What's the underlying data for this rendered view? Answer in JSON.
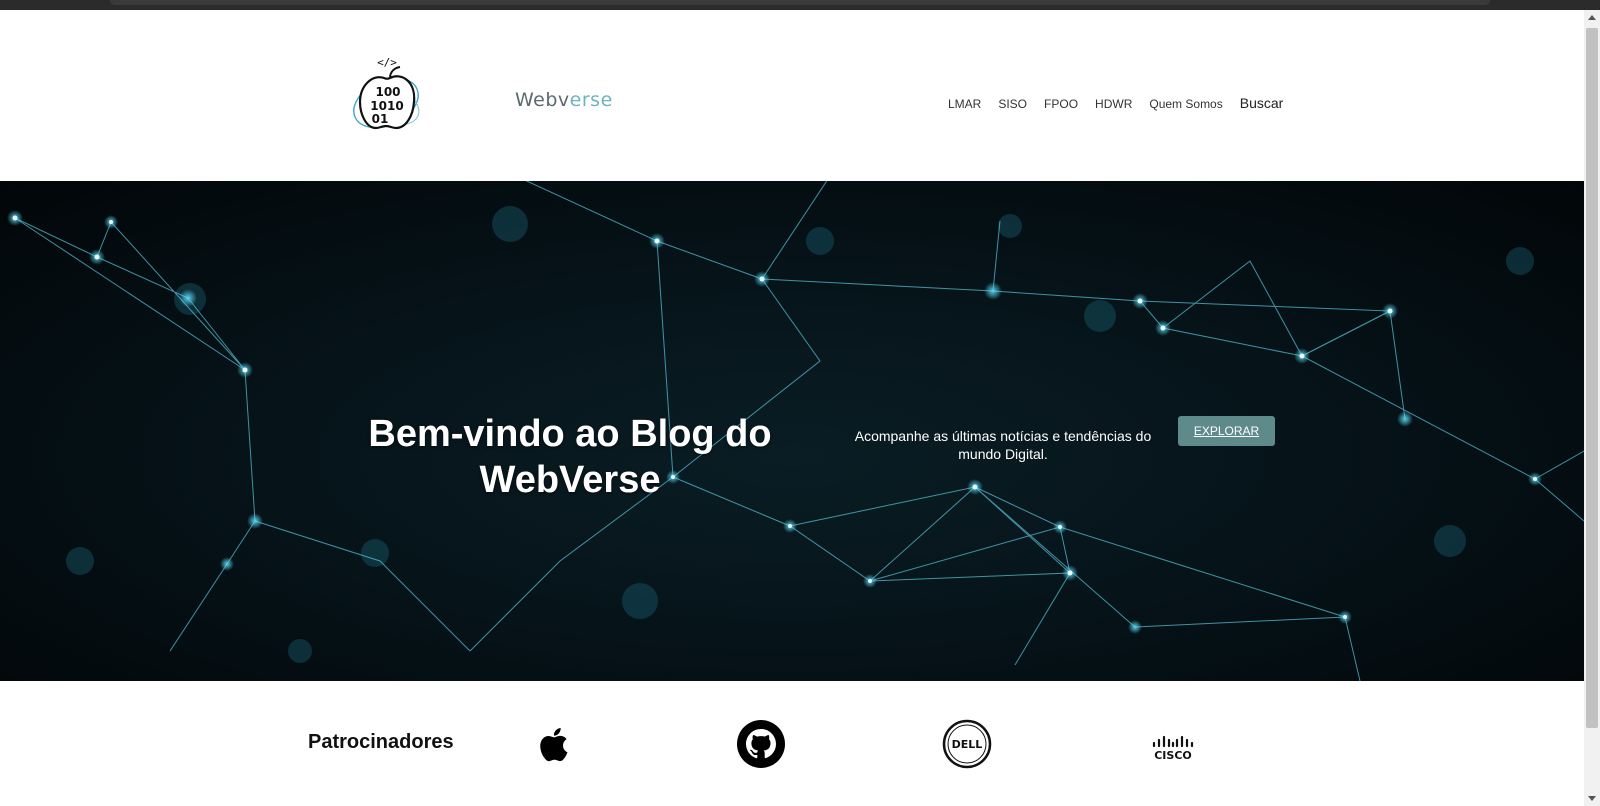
{
  "header": {
    "logo_icon": "apple-binary-logo-icon",
    "logo_text": {
      "tag": "</>",
      "line1": "100",
      "line2": "1010",
      "line3": "01"
    },
    "brand": {
      "part1": "Webv",
      "part2": "erse",
      "color1": "#5b6b6d",
      "color2": "#6fb3bf"
    },
    "nav": {
      "items": [
        {
          "label": "LMAR"
        },
        {
          "label": "SISO"
        },
        {
          "label": "FPOO"
        },
        {
          "label": "HDWR"
        },
        {
          "label": "Quem Somos"
        }
      ],
      "search_label": "Buscar"
    }
  },
  "hero": {
    "background": "network-lines-image",
    "title": "Bem-vindo ao Blog do WebVerse",
    "subtitle": "Acompanhe as últimas notícias e tendências do mundo Digital.",
    "button_label": "EXPLORAR",
    "accent": "#5f8a8b"
  },
  "sponsors": {
    "title": "Patrocinadores",
    "items": [
      {
        "icon": "apple-icon"
      },
      {
        "icon": "github-icon"
      },
      {
        "icon": "dell-icon",
        "label": "DELL"
      },
      {
        "icon": "cisco-icon",
        "label": "CISCO"
      }
    ]
  }
}
